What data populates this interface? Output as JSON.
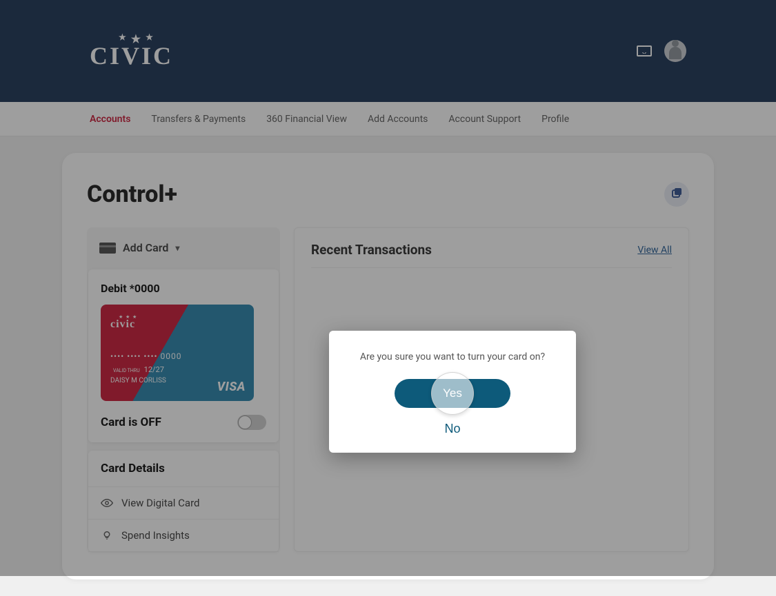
{
  "brand": "CIVIC",
  "nav": {
    "items": [
      {
        "label": "Accounts",
        "active": true
      },
      {
        "label": "Transfers & Payments",
        "active": false
      },
      {
        "label": "360 Financial View",
        "active": false
      },
      {
        "label": "Add Accounts",
        "active": false
      },
      {
        "label": "Account Support",
        "active": false
      },
      {
        "label": "Profile",
        "active": false
      }
    ]
  },
  "panel": {
    "title": "Control+"
  },
  "add_card": {
    "label": "Add Card"
  },
  "card": {
    "label": "Debit *0000",
    "brand": "civic",
    "number": "•••• •••• •••• 0000",
    "valid_label": "VALID THRU",
    "valid_thru": "12/27",
    "holder": "DAISY M CORLISS",
    "network": "VISA",
    "toggle_label": "Card is OFF"
  },
  "details": {
    "title": "Card Details",
    "items": [
      {
        "icon": "eye",
        "label": "View Digital Card"
      },
      {
        "icon": "bulb",
        "label": "Spend Insights"
      }
    ]
  },
  "transactions": {
    "title": "Recent Transactions",
    "view_all": "View All"
  },
  "modal": {
    "message": "Are you sure you want to turn your card on?",
    "yes": "Yes",
    "no": "No"
  }
}
